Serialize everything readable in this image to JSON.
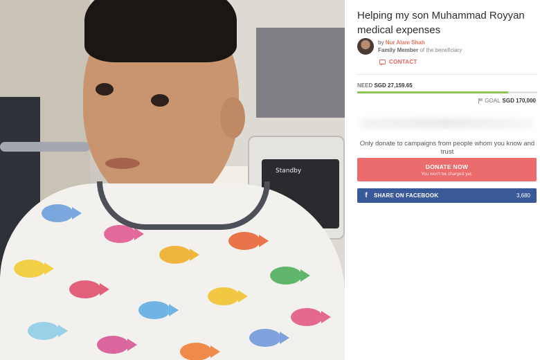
{
  "campaign": {
    "title": "Helping my son Muhammad Royyan medical expenses",
    "by_prefix": "by",
    "organizer_name": "Nur Alam Shah",
    "organizer_role": "Family Member",
    "role_suffix": "of the beneficiary",
    "contact_label": "CONTACT"
  },
  "photo": {
    "monitor_label": "Standby"
  },
  "funding": {
    "need_label": "NEED",
    "need_amount": "SGD 27,159.65",
    "goal_label": "GOAL",
    "goal_amount": "SGD 170,000",
    "progress_fraction": 0.84,
    "progress_color": "#8fc450"
  },
  "notice": "Only donate to campaigns from people whom you know and trust",
  "donate": {
    "label": "DONATE NOW",
    "sublabel": "You won't be charged yet.",
    "color": "#ea6c6c"
  },
  "share": {
    "icon": "facebook-icon",
    "label": "SHARE ON FACEBOOK",
    "count": "3,680",
    "color": "#3a5998"
  }
}
